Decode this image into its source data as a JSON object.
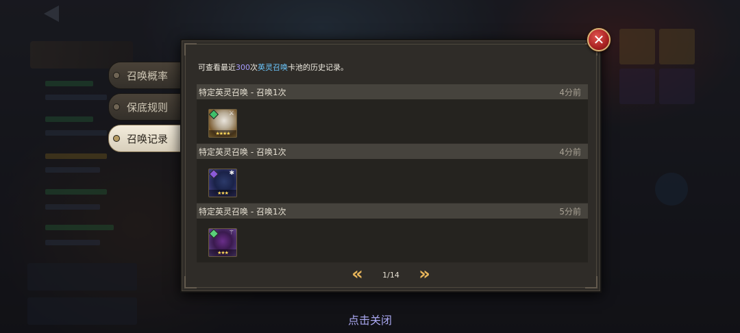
{
  "tabs": [
    {
      "label": "召唤概率",
      "active": false
    },
    {
      "label": "保底规则",
      "active": false
    },
    {
      "label": "召唤记录",
      "active": true
    }
  ],
  "intro": {
    "prefix": "可查看最近",
    "count": "300",
    "mid": "次",
    "pool": "英灵召唤",
    "suffix": "卡池的历史记录。"
  },
  "records": [
    {
      "title": "特定英灵召唤 - 召唤1次",
      "time": "4分前",
      "hero_icon": "hero-white-hair-portrait",
      "stars": "★★★★",
      "element_color": "#3fbf6a"
    },
    {
      "title": "特定英灵召唤 - 召唤1次",
      "time": "4分前",
      "hero_icon": "hero-dark-cloak-portrait",
      "stars": "★★★",
      "element_color": "#8a5ad8"
    },
    {
      "title": "特定英灵召唤 - 召唤1次",
      "time": "5分前",
      "hero_icon": "hero-purple-mage-portrait",
      "stars": "★★★",
      "element_color": "#5ad07a"
    }
  ],
  "pagination": {
    "current": "1/14"
  },
  "close_hint": "点击关闭",
  "colors": {
    "accent_gold": "#e6b45a",
    "count_purple": "#a79cff",
    "pool_blue": "#6cc8ff",
    "close_red": "#a82222"
  }
}
